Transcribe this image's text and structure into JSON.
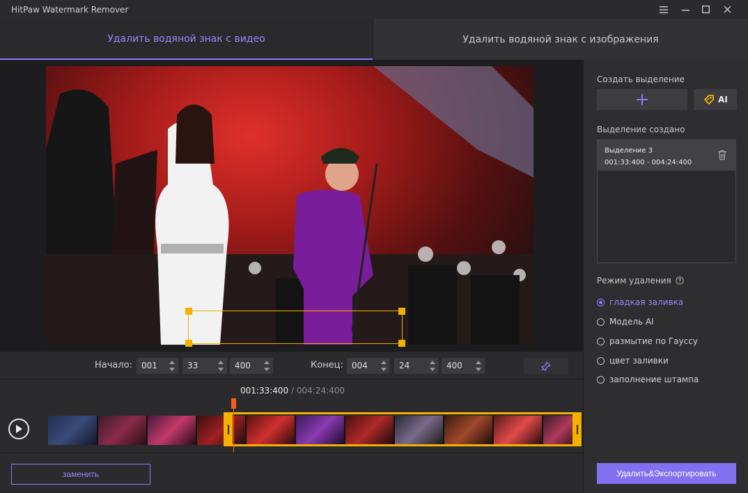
{
  "window": {
    "title": "HitPaw Watermark Remover"
  },
  "tabs": [
    {
      "label": "Удалить водяной знак с видео"
    },
    {
      "label": "Удалить водяной знак с изображения"
    }
  ],
  "range": {
    "start_label": "Начало:",
    "start": [
      "001",
      "33",
      "400"
    ],
    "end_label": "Конец:",
    "end": [
      "004",
      "24",
      "400"
    ]
  },
  "timeline": {
    "current": "001:33:400",
    "separator": "/",
    "total": "004:24:400"
  },
  "bottom": {
    "replace_label": "заменить"
  },
  "sidebar": {
    "create_title": "Создать выделение",
    "ai_label": "AI",
    "created_title": "Выделение создано",
    "selections": [
      {
        "name": "Выделение 3",
        "time": "001:33:400 - 004:24:400"
      }
    ],
    "mode_title": "Режим удаления",
    "modes": [
      {
        "label": "гладкая заливка",
        "selected": true
      },
      {
        "label": "Модель AI",
        "selected": false
      },
      {
        "label": "размытие по Гауссу",
        "selected": false
      },
      {
        "label": "цвет заливки",
        "selected": false
      },
      {
        "label": "заполнение штампа",
        "selected": false
      }
    ],
    "export_label": "Удалить&Экспортировать"
  },
  "colors": {
    "accent": "#8a78ff",
    "selection": "#f5b100",
    "playhead": "#ff5a1c"
  }
}
